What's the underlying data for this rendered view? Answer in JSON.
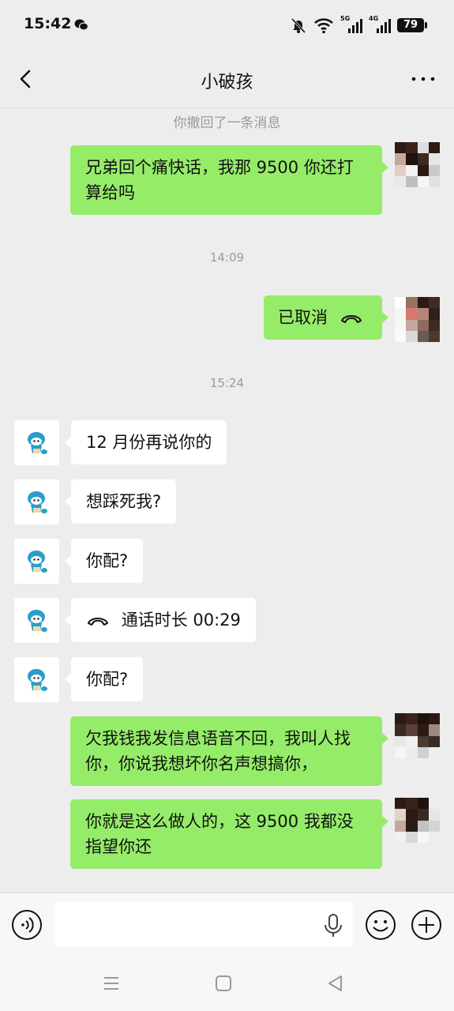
{
  "status_bar": {
    "time": "15:42",
    "icons": [
      "wechat-icon",
      "bell-muted-icon",
      "wifi-icon",
      "signal-5g-icon",
      "signal-4g-icon"
    ],
    "net1_label": "5G",
    "net2_label": "4G",
    "battery": "79"
  },
  "nav": {
    "title": "小破孩",
    "back_icon": "chevron-left-icon",
    "more_icon": "more-dots-icon"
  },
  "chat": {
    "recall_notice": "你撤回了一条消息",
    "msg1": "兄弟回个痛快话，我那 9500 你还打算给吗",
    "time1": "14:09",
    "call_cancelled": "已取消",
    "time2": "15:24",
    "msg2": "12 月份再说你的",
    "msg3": "想踩死我?",
    "msg4": "你配?",
    "call_duration": "通话时长 00:29",
    "msg5": "你配?",
    "msg6": "欠我钱我发信息语音不回，我叫人找你，你说我想坏你名声想搞你，",
    "msg7": "你就是这么做人的，这 9500 我都没指望你还"
  },
  "input_bar": {
    "placeholder": "",
    "icons": [
      "voice-icon",
      "mic-icon",
      "emoji-icon",
      "plus-icon"
    ]
  },
  "system_nav": {
    "icons": [
      "menu-icon",
      "home-icon",
      "back-triangle-icon"
    ]
  },
  "colors": {
    "background": "#ededed",
    "outgoing_bubble": "#95ec69",
    "incoming_bubble": "#ffffff",
    "meta_text": "#9b9b9b"
  }
}
